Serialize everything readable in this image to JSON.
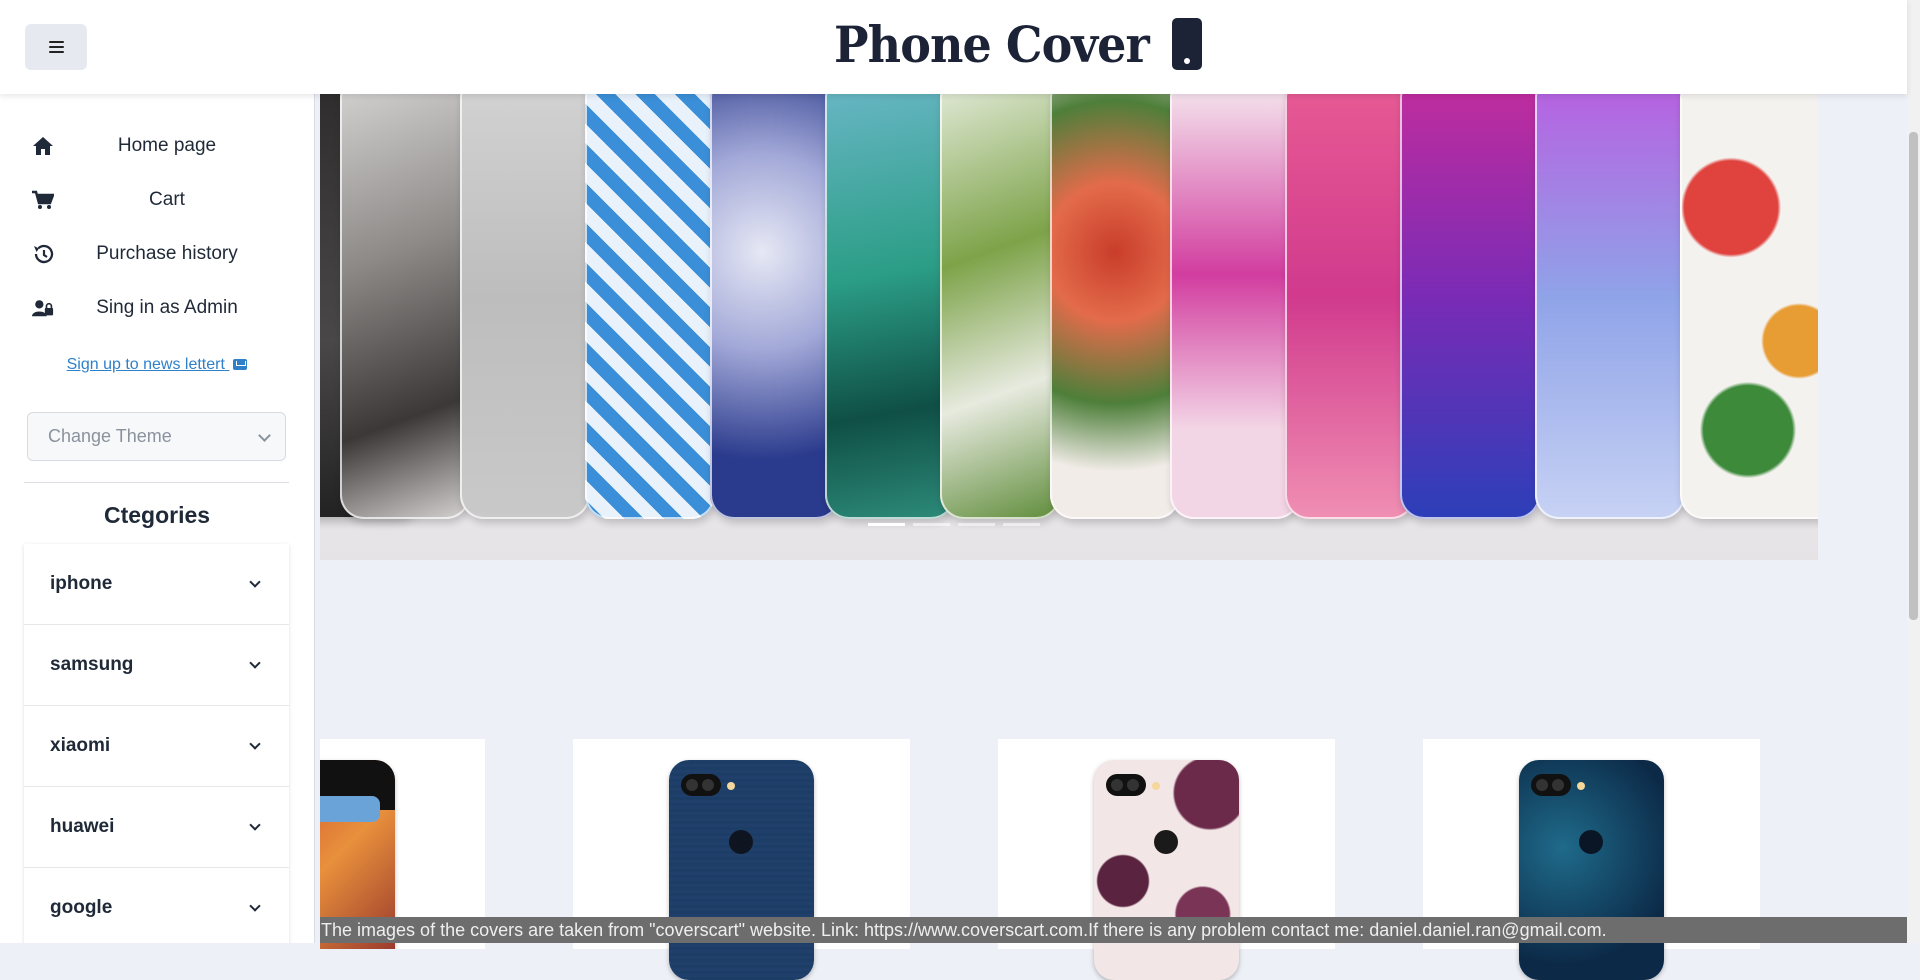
{
  "header": {
    "menu_button_icon": "hamburger-icon",
    "brand_title": "Phone Cover",
    "brand_icon": "phone-icon"
  },
  "sidebar": {
    "nav": [
      {
        "label": "Home page",
        "icon": "home-icon"
      },
      {
        "label": "Cart",
        "icon": "cart-icon"
      },
      {
        "label": "Purchase history",
        "icon": "history-icon"
      },
      {
        "label": "Sing in as Admin",
        "icon": "admin-lock-icon"
      }
    ],
    "newsletter_link": "Sign up to news lettert",
    "newsletter_icon": "mail-icon",
    "theme_select": {
      "placeholder": "Change Theme"
    },
    "categories_title": "Ctegories",
    "categories": [
      "iphone",
      "samsung",
      "xiaomi",
      "huawei",
      "google"
    ]
  },
  "carousel": {
    "slide_count": 4,
    "active_slide": 1
  },
  "footer": {
    "notice": "ject.The images of the covers are taken from \"coverscart\" website. Link: https://www.coverscart.com.If there is any problem contact me: daniel.daniel.ran@gmail.com."
  },
  "colors": {
    "brand": "#1c2336",
    "link": "#2f80c9",
    "page_background": "#edf0f7",
    "footer_background": "#6d6d6d"
  }
}
